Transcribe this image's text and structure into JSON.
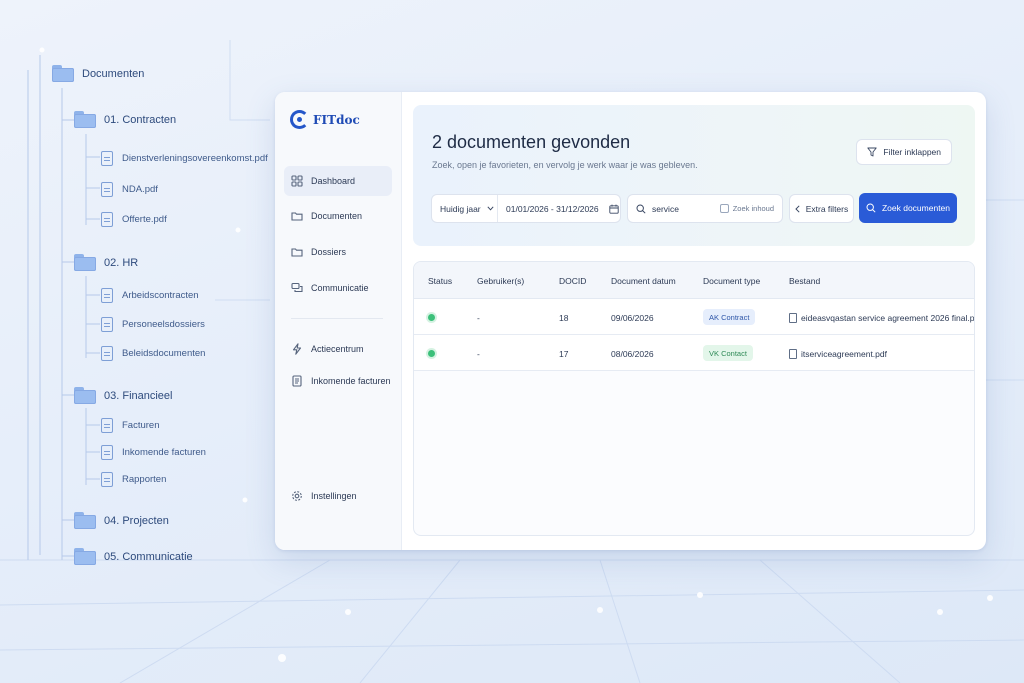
{
  "tree": {
    "root": "Documenten",
    "folders": [
      {
        "label": "01. Contracten",
        "files": [
          "Dienstverleningsovereenkomst.pdf",
          "NDA.pdf",
          "Offerte.pdf"
        ]
      },
      {
        "label": "02. HR",
        "files": [
          "Arbeidscontracten",
          "Personeelsdossiers",
          "Beleidsdocumenten"
        ]
      },
      {
        "label": "03. Financieel",
        "files": [
          "Facturen",
          "Inkomende facturen",
          "Rapporten"
        ]
      },
      {
        "label": "04. Projecten",
        "files": []
      },
      {
        "label": "05. Communicatie",
        "files": []
      }
    ]
  },
  "app": {
    "logo": "FITdoc",
    "nav": [
      {
        "label": "Dashboard",
        "icon": "grid-icon",
        "active": true
      },
      {
        "label": "Documenten",
        "icon": "folder-icon"
      },
      {
        "label": "Dossiers",
        "icon": "folder-icon"
      },
      {
        "label": "Communicatie",
        "icon": "chat-icon"
      },
      {
        "label": "Actiecentrum",
        "icon": "bolt-icon"
      },
      {
        "label": "Inkomende facturen",
        "icon": "document-icon"
      },
      {
        "label": "Instellingen",
        "icon": "gear-icon"
      }
    ]
  },
  "hero": {
    "title": "2 documenten gevonden",
    "subtitle": "Zoek, open je favorieten, en vervolg je werk waar je was gebleven.",
    "filter_toggle": "Filter inklappen"
  },
  "filters": {
    "period": "Huidig jaar",
    "date_range": "01/01/2026 - 31/12/2026",
    "search_value": "service",
    "search_content_label": "Zoek inhoud",
    "extra_filters": "Extra filters",
    "search_button": "Zoek documenten"
  },
  "table": {
    "columns": [
      "Status",
      "Gebruiker(s)",
      "DOCID",
      "Document datum",
      "Document type",
      "Bestand"
    ],
    "rows": [
      {
        "status": "active",
        "user": "-",
        "docid": "18",
        "date": "09/06/2026",
        "type": "AK Contract",
        "file": "eideasvqastan service agreement 2026 final.pdf"
      },
      {
        "status": "active",
        "user": "-",
        "docid": "17",
        "date": "08/06/2026",
        "type": "VK Contact",
        "file": "itserviceagreement.pdf"
      }
    ]
  },
  "colors": {
    "accent": "#2a5bd7",
    "status_active": "#3cc07a",
    "badge_blue": "#e6eefc",
    "badge_green": "#e3f6ea"
  }
}
